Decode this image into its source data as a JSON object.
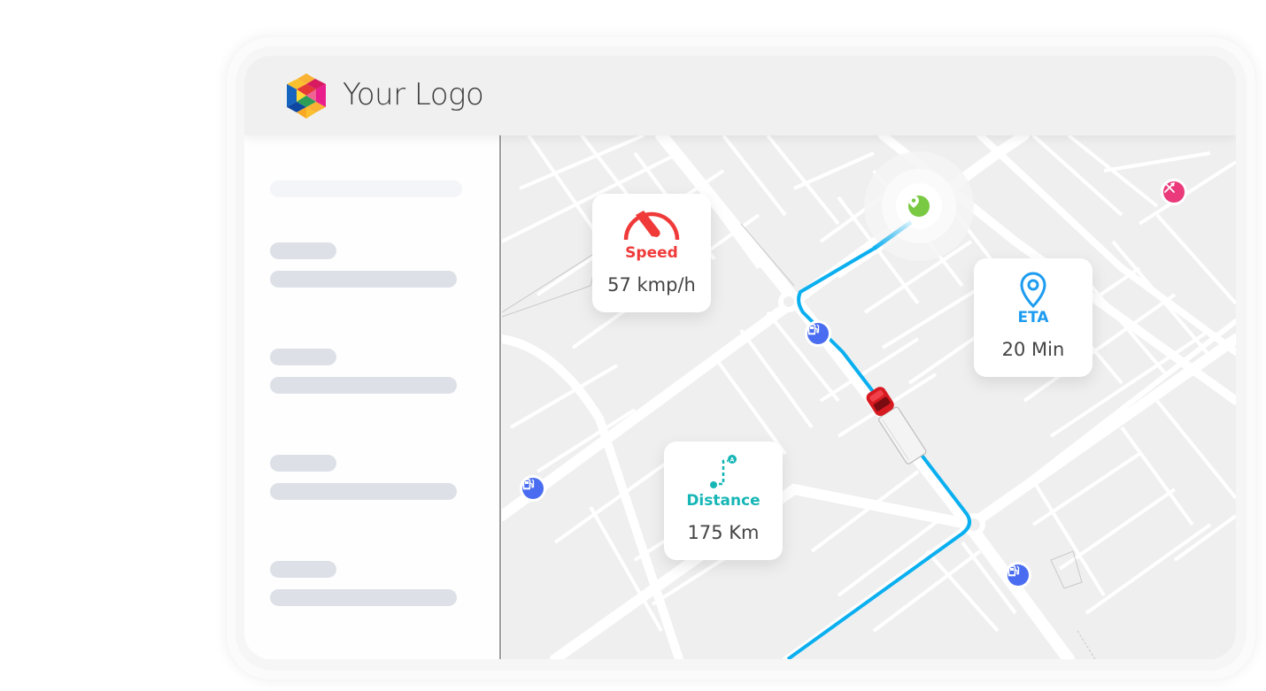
{
  "header": {
    "logo_text": "Your Logo",
    "logo_icon": "hexagon-logo-icon"
  },
  "sidebar": {
    "search_placeholder": "",
    "items": [
      {
        "title": "",
        "subtitle": ""
      },
      {
        "title": "",
        "subtitle": ""
      },
      {
        "title": "",
        "subtitle": ""
      },
      {
        "title": "",
        "subtitle": ""
      }
    ]
  },
  "map": {
    "route_color": "#0aaff0",
    "destination_icon": "location-pin-icon",
    "destination_color": "#7ac943",
    "vehicle_icon": "truck-icon",
    "pois": [
      {
        "type": "fuel-station",
        "icon": "fuel-pump-icon",
        "color": "#4a6cf0"
      },
      {
        "type": "fuel-station",
        "icon": "fuel-pump-icon",
        "color": "#4a6cf0"
      },
      {
        "type": "fuel-station",
        "icon": "fuel-pump-icon",
        "color": "#4a6cf0"
      },
      {
        "type": "restaurant",
        "icon": "fork-knife-icon",
        "color": "#ea3a7b"
      }
    ]
  },
  "stats": {
    "speed": {
      "label": "Speed",
      "value": "57 kmp/h",
      "icon": "speedometer-icon",
      "color": "#f03a3a"
    },
    "eta": {
      "label": "ETA",
      "value": "20 Min",
      "icon": "map-pin-icon",
      "color": "#1e9cf0"
    },
    "distance": {
      "label": "Distance",
      "value": "175 Km",
      "icon": "route-icon",
      "color": "#17b6b6"
    }
  }
}
